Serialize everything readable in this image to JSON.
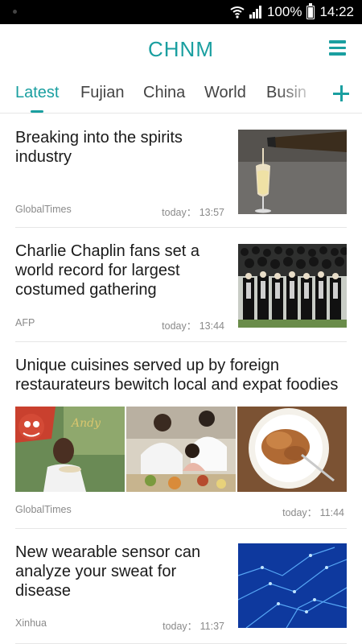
{
  "status_bar": {
    "battery": "100%",
    "time": "14:22"
  },
  "header": {
    "title": "CHNM"
  },
  "tabs": [
    {
      "label": "Latest"
    },
    {
      "label": "Fujian"
    },
    {
      "label": "China"
    },
    {
      "label": "World"
    },
    {
      "label": "Busin"
    }
  ],
  "articles": [
    {
      "title": "Breaking into the spirits industry",
      "source": "GlobalTimes",
      "time": "today： 13:57"
    },
    {
      "title": "Charlie Chaplin fans set a world record for largest costumed gathering",
      "source": "AFP",
      "time": "today： 13:44"
    },
    {
      "title": "Unique cuisines served up by foreign restaurateurs bewitch local and expat foodies",
      "source": "GlobalTimes",
      "time": "today： 11:44"
    },
    {
      "title": "New wearable sensor can analyze your sweat for disease",
      "source": "Xinhua",
      "time": "today： 11:37"
    }
  ],
  "colors": {
    "accent": "#1a9fa0"
  }
}
